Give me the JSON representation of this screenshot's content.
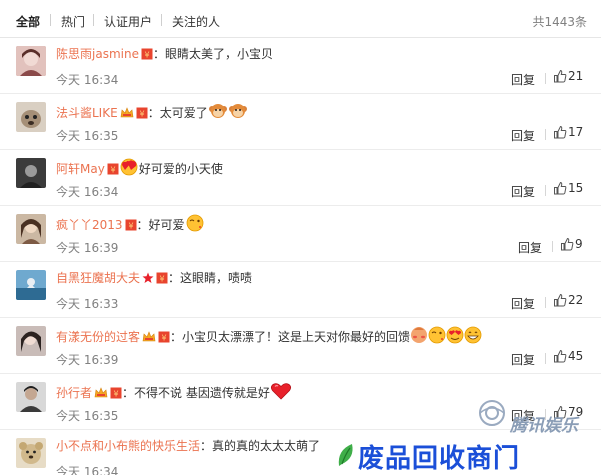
{
  "tabs": [
    {
      "label": "全部"
    },
    {
      "label": "热门"
    },
    {
      "label": "认证用户"
    },
    {
      "label": "关注的人"
    }
  ],
  "total": "共1443条",
  "comments": [
    {
      "name": "陈思雨jasmine",
      "text": "：眼睛太美了，小宝贝",
      "time": "今天 16:34",
      "reply": "回复",
      "likes": "21",
      "avatar_color": "#c9a2a0"
    },
    {
      "name": "法斗酱LIKE",
      "text": "：太可爱了",
      "time": "今天 16:35",
      "reply": "回复",
      "likes": "17",
      "avatar_color": "#a58f77"
    },
    {
      "name": "阿轩May",
      "text": "好可爱的小天使",
      "time": "今天 16:34",
      "reply": "回复",
      "likes": "15",
      "avatar_color": "#5c5c5c"
    },
    {
      "name": "疯丫丫2013",
      "text": "：好可爱",
      "time": "今天 16:39",
      "reply": "回复",
      "likes": "9",
      "avatar_color": "#b7a08c"
    },
    {
      "name": "自黑狂魔胡大夫",
      "text": "：这眼睛，啧啧",
      "time": "今天 16:33",
      "reply": "回复",
      "likes": "22",
      "avatar_color": "#3e7fa8"
    },
    {
      "name": "有漾无份的过客",
      "text": "：小宝贝太漂漂了！这是上天对你最好的回馈",
      "time": "今天 16:39",
      "reply": "回复",
      "likes": "45",
      "avatar_color": "#7a6a66"
    },
    {
      "name": "孙行者",
      "text": "：不得不说 基因遗传就是好",
      "time": "今天 16:35",
      "reply": "回复",
      "likes": "79",
      "avatar_color": "#6e6e6e"
    },
    {
      "name": "小不点和小布熊的快乐生活",
      "text": "：真的真的太太太萌了",
      "time": "今天 16:34",
      "reply": "",
      "likes": "",
      "avatar_color": "#d8c7a6"
    }
  ],
  "watermark": {
    "site": "腾讯娱乐",
    "text": "废品回收商门"
  },
  "colors": {
    "username": "#eb7350",
    "time": "#808080",
    "red_badge": "#e8442e",
    "emoji_yellow": "#ffc233"
  }
}
